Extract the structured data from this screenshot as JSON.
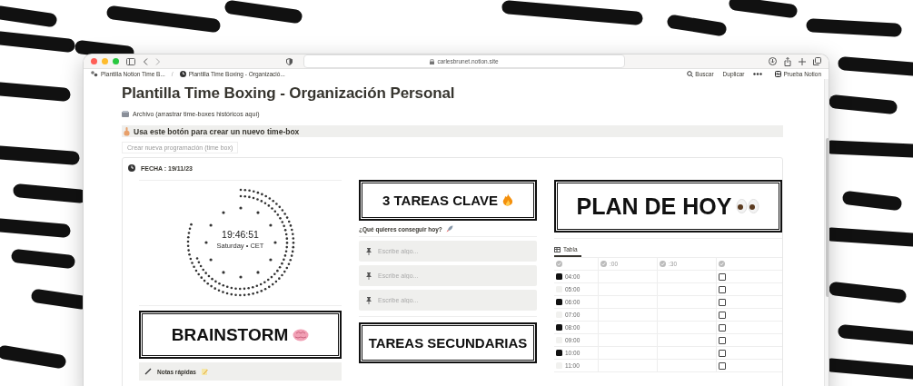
{
  "browser": {
    "url": "carlesbrunet.notion.site"
  },
  "breadcrumb_separator": "/",
  "breadcrumbs": [
    {
      "label": "Plantilla Notion Time B..."
    },
    {
      "label": "Plantilla Time Boxing - Organizació..."
    }
  ],
  "topbar": {
    "search": "Buscar",
    "duplicate": "Duplicar",
    "cta": "Prueba Notion"
  },
  "page": {
    "title": "Plantilla Time Boxing - Organización Personal",
    "archive_link": "Archivo (arrastrar time-boxes históricos aquí)",
    "callout": "Usa este botón para crear un nuevo time-box",
    "button": "Crear nueva programación (time box)"
  },
  "card": {
    "date_label": "FECHA : 19/11/23",
    "clock": {
      "time": "19:46:51",
      "subtitle": "Saturday • CET"
    },
    "brainstorm": {
      "heading": "BRAINSTORM",
      "notes": "Notas rápidas"
    },
    "key_tasks": {
      "heading": "3 TAREAS CLAVE",
      "question": "¿Qué quieres conseguir hoy?",
      "inputs": [
        {
          "placeholder": "Escribe algo..."
        },
        {
          "placeholder": "Escribe algo..."
        },
        {
          "placeholder": "Escribe algo..."
        }
      ]
    },
    "secondary": {
      "heading": "TAREAS SECUNDARIAS"
    },
    "plan": {
      "heading": "PLAN DE HOY",
      "view_tab": "Tabla",
      "columns": [
        ":00",
        ":30"
      ],
      "rows": [
        {
          "time": "04:00",
          "color": "#111111",
          "checked": false
        },
        {
          "time": "05:00",
          "color": "#f1f1ef",
          "checked": false
        },
        {
          "time": "06:00",
          "color": "#111111",
          "checked": false
        },
        {
          "time": "07:00",
          "color": "#f1f1ef",
          "checked": false
        },
        {
          "time": "08:00",
          "color": "#111111",
          "checked": false
        },
        {
          "time": "09:00",
          "color": "#f1f1ef",
          "checked": false
        },
        {
          "time": "10:00",
          "color": "#111111",
          "checked": false
        },
        {
          "time": "11:00",
          "color": "#f1f1ef",
          "checked": false
        }
      ]
    }
  }
}
